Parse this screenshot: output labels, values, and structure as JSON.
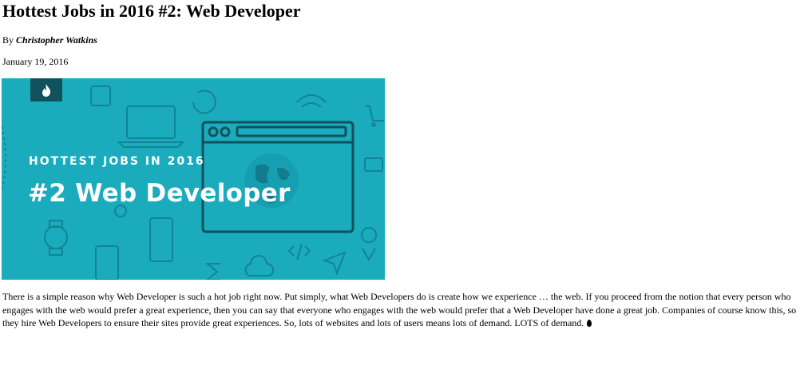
{
  "article": {
    "title": "Hottest Jobs in 2016 #2: Web Developer",
    "byline_prefix": "By",
    "author": "Christopher Watkins",
    "date": "January 19, 2016",
    "hero": {
      "kicker": "HOTTEST JOBS IN 2016",
      "title": "#2 Web Developer",
      "bg_color": "#1aabbd",
      "badge_color": "#10525c",
      "badge_icon": "flame-icon"
    },
    "body": "There is a simple reason why Web Developer is such a hot job right now. Put simply, what Web Developers do is create how we experience … the web. If you proceed from the notion that every person who engages with the web would prefer a great experience, then you can say that everyone who engages with the web would prefer that a Web Developer have done a great job. Companies of course know this, so they hire Web Developers to ensure their sites provide great experiences. So, lots of websites and lots of users means lots of demand. LOTS of demand.",
    "trailing_icon": "flame-icon"
  }
}
